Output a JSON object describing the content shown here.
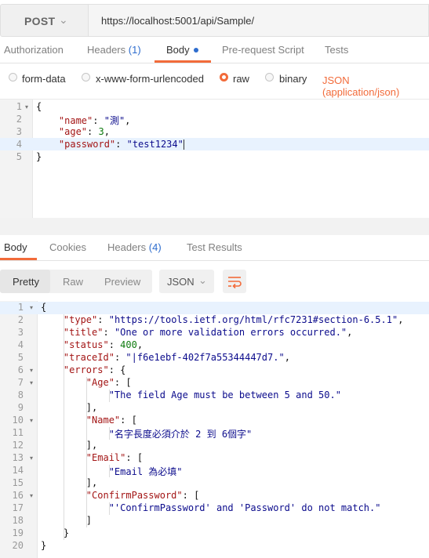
{
  "url_bar": {
    "method": "POST",
    "url": "https://localhost:5001/api/Sample/"
  },
  "request_tabs": [
    {
      "label": "Authorization"
    },
    {
      "label": "Headers",
      "count": "(1)"
    },
    {
      "label": "Body",
      "active": true,
      "has_dot": true
    },
    {
      "label": "Pre-request Script"
    },
    {
      "label": "Tests"
    }
  ],
  "body_types": {
    "options": [
      "form-data",
      "x-www-form-urlencoded",
      "raw",
      "binary"
    ],
    "selected": "raw",
    "content_type": "JSON (application/json)"
  },
  "request_body": {
    "line_numbers": [
      "1",
      "2",
      "3",
      "4",
      "5"
    ],
    "open_brace": "{",
    "close_brace": "}",
    "name_key": "\"name\"",
    "name_val": "\"測\"",
    "age_key": "\"age\"",
    "age_val": "3",
    "password_key": "\"password\"",
    "password_val": "\"test1234\""
  },
  "response_tabs": [
    {
      "label": "Body",
      "active": true
    },
    {
      "label": "Cookies"
    },
    {
      "label": "Headers",
      "count": "(4)"
    },
    {
      "label": "Test Results"
    }
  ],
  "response_toolbar": {
    "views": [
      "Pretty",
      "Raw",
      "Preview"
    ],
    "selected_view": "Pretty",
    "format": "JSON",
    "wrap_icon": "wrap-lines-icon"
  },
  "response_body": {
    "line_numbers": [
      "1",
      "2",
      "3",
      "4",
      "5",
      "6",
      "7",
      "8",
      "9",
      "10",
      "11",
      "12",
      "13",
      "14",
      "15",
      "16",
      "17",
      "18",
      "19",
      "20"
    ],
    "type_key": "\"type\"",
    "type_val": "\"https://tools.ietf.org/html/rfc7231#section-6.5.1\"",
    "title_key": "\"title\"",
    "title_val": "\"One or more validation errors occurred.\"",
    "status_key": "\"status\"",
    "status_val": "400",
    "traceId_key": "\"traceId\"",
    "traceId_val": "\"|f6e1ebf-402f7a55344447d7.\"",
    "errors_key": "\"errors\"",
    "age_key": "\"Age\"",
    "age_msg": "\"The field Age must be between 5 and 50.\"",
    "name_key": "\"Name\"",
    "name_msg": "\"名字長度必須介於 2 到 6個字\"",
    "email_key": "\"Email\"",
    "email_msg": "\"Email 為必填\"",
    "confirm_key": "\"ConfirmPassword\"",
    "confirm_msg": "\"'ConfirmPassword' and 'Password' do not match.\""
  },
  "colors": {
    "accent": "#f26b3a",
    "tab_count": "#2e6dce",
    "json_key": "#a31515",
    "json_string": "#0b0b8c",
    "json_number": "#0e7a0e"
  }
}
